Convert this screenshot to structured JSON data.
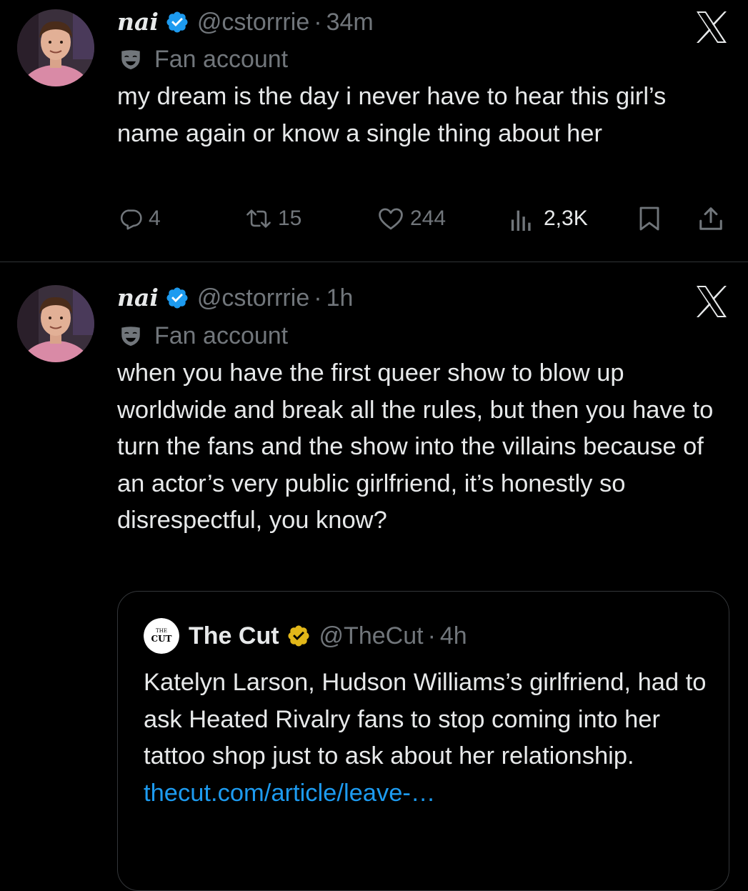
{
  "tweets": [
    {
      "display_name": "nai",
      "handle": "@cstorrrie",
      "separator": "·",
      "time": "34m",
      "label": "Fan account",
      "text": "my dream is the day i never have to hear this girl’s name again or know a single thing about her",
      "metrics": {
        "replies": "4",
        "retweets": "15",
        "likes": "244",
        "views": "2,3K"
      }
    },
    {
      "display_name": "nai",
      "handle": "@cstorrrie",
      "separator": "·",
      "time": "1h",
      "label": "Fan account",
      "text": "when you have the first queer show to blow up worldwide and break all the rules, but then you have to turn the fans and the show into the villains because of an actor’s very public girlfriend, it’s honestly so disrespectful, you know?",
      "quote": {
        "name": "The Cut",
        "handle": "@TheCut",
        "separator": "·",
        "time": "4h",
        "logo_text_top": "THE",
        "logo_text": "CUT",
        "text": "Katelyn Larson, Hudson Williams’s girlfriend, had to ask Heated Rivalry fans to stop coming into her tattoo shop just to ask about her relationship.",
        "link": "thecut.com/article/leave-…"
      }
    }
  ],
  "colors": {
    "background": "#000000",
    "text_primary": "#e7e9ea",
    "text_secondary": "#71767b",
    "verified_blue": "#1d9bf0",
    "verified_gold": "#e2b719",
    "link": "#1d9bf0"
  },
  "icons": {
    "verified": "verified-badge-icon",
    "verified_gold": "gold-verified-badge-icon",
    "close": "x-logo-icon",
    "label": "mask-icon",
    "reply": "reply-icon",
    "retweet": "retweet-icon",
    "like": "heart-icon",
    "views": "views-icon",
    "bookmark": "bookmark-icon",
    "share": "share-icon"
  }
}
